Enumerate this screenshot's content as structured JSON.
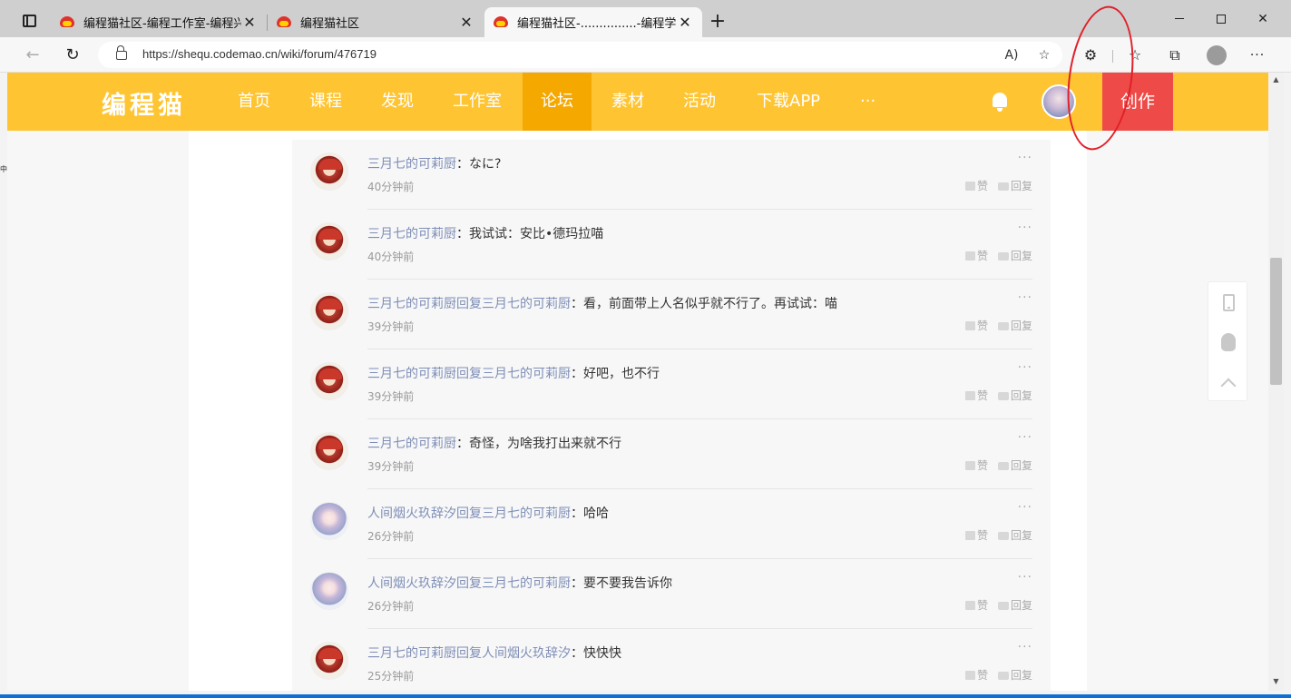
{
  "browser": {
    "tabs": [
      {
        "title": "编程猫社区-编程工作室-编程兴趣",
        "active": false
      },
      {
        "title": "编程猫社区",
        "active": false
      },
      {
        "title": "编程猫社区-...............-编程学习交",
        "active": true
      }
    ],
    "url": "https://shequ.codemao.cn/wiki/forum/476719",
    "close_glyph": "✕",
    "new_tab_glyph": "+",
    "back_glyph": "←",
    "reload_glyph": "↻",
    "read_aloud_glyph": "A)",
    "favorite_add_glyph": "☆",
    "extensions_glyph": "⚙",
    "favorites_glyph": "☆",
    "collections_glyph": "⧉",
    "more_glyph": "···",
    "minimize_glyph": "",
    "close_window_glyph": "✕"
  },
  "site": {
    "logo": "编程猫",
    "nav": [
      {
        "label": "首页"
      },
      {
        "label": "课程"
      },
      {
        "label": "发现"
      },
      {
        "label": "工作室"
      },
      {
        "label": "论坛",
        "active": true
      },
      {
        "label": "素材"
      },
      {
        "label": "活动"
      },
      {
        "label": "下载APP"
      },
      {
        "label": "···"
      }
    ],
    "create_label": "创作",
    "accent_color": "#ffc431",
    "active_nav_color": "#f5a800",
    "create_color": "#ee4b48"
  },
  "replies": [
    {
      "author": "三月七的可莉厨",
      "text": "：なに?",
      "time": "40分钟前",
      "avatar": "klee"
    },
    {
      "author": "三月七的可莉厨",
      "text": "：我试试：安比•德玛拉喵",
      "time": "40分钟前",
      "avatar": "klee"
    },
    {
      "author": "三月七的可莉厨回复三月七的可莉厨",
      "text": "：看，前面带上人名似乎就不行了。再试试：喵",
      "time": "39分钟前",
      "avatar": "klee"
    },
    {
      "author": "三月七的可莉厨回复三月七的可莉厨",
      "text": "：好吧，也不行",
      "time": "39分钟前",
      "avatar": "klee"
    },
    {
      "author": "三月七的可莉厨",
      "text": "：奇怪，为啥我打出来就不行",
      "time": "39分钟前",
      "avatar": "klee"
    },
    {
      "author": "人间烟火玖辞汐回复三月七的可莉厨",
      "text": "：哈哈",
      "time": "26分钟前",
      "avatar": "girl"
    },
    {
      "author": "人间烟火玖辞汐回复三月七的可莉厨",
      "text": "：要不要我告诉你",
      "time": "26分钟前",
      "avatar": "girl"
    },
    {
      "author": "三月七的可莉厨回复人间烟火玖辞汐",
      "text": "：快快快",
      "time": "25分钟前",
      "avatar": "klee"
    }
  ],
  "reply_actions": {
    "like": "赞",
    "reply": "回复",
    "more": "···"
  },
  "left_mark": "中"
}
